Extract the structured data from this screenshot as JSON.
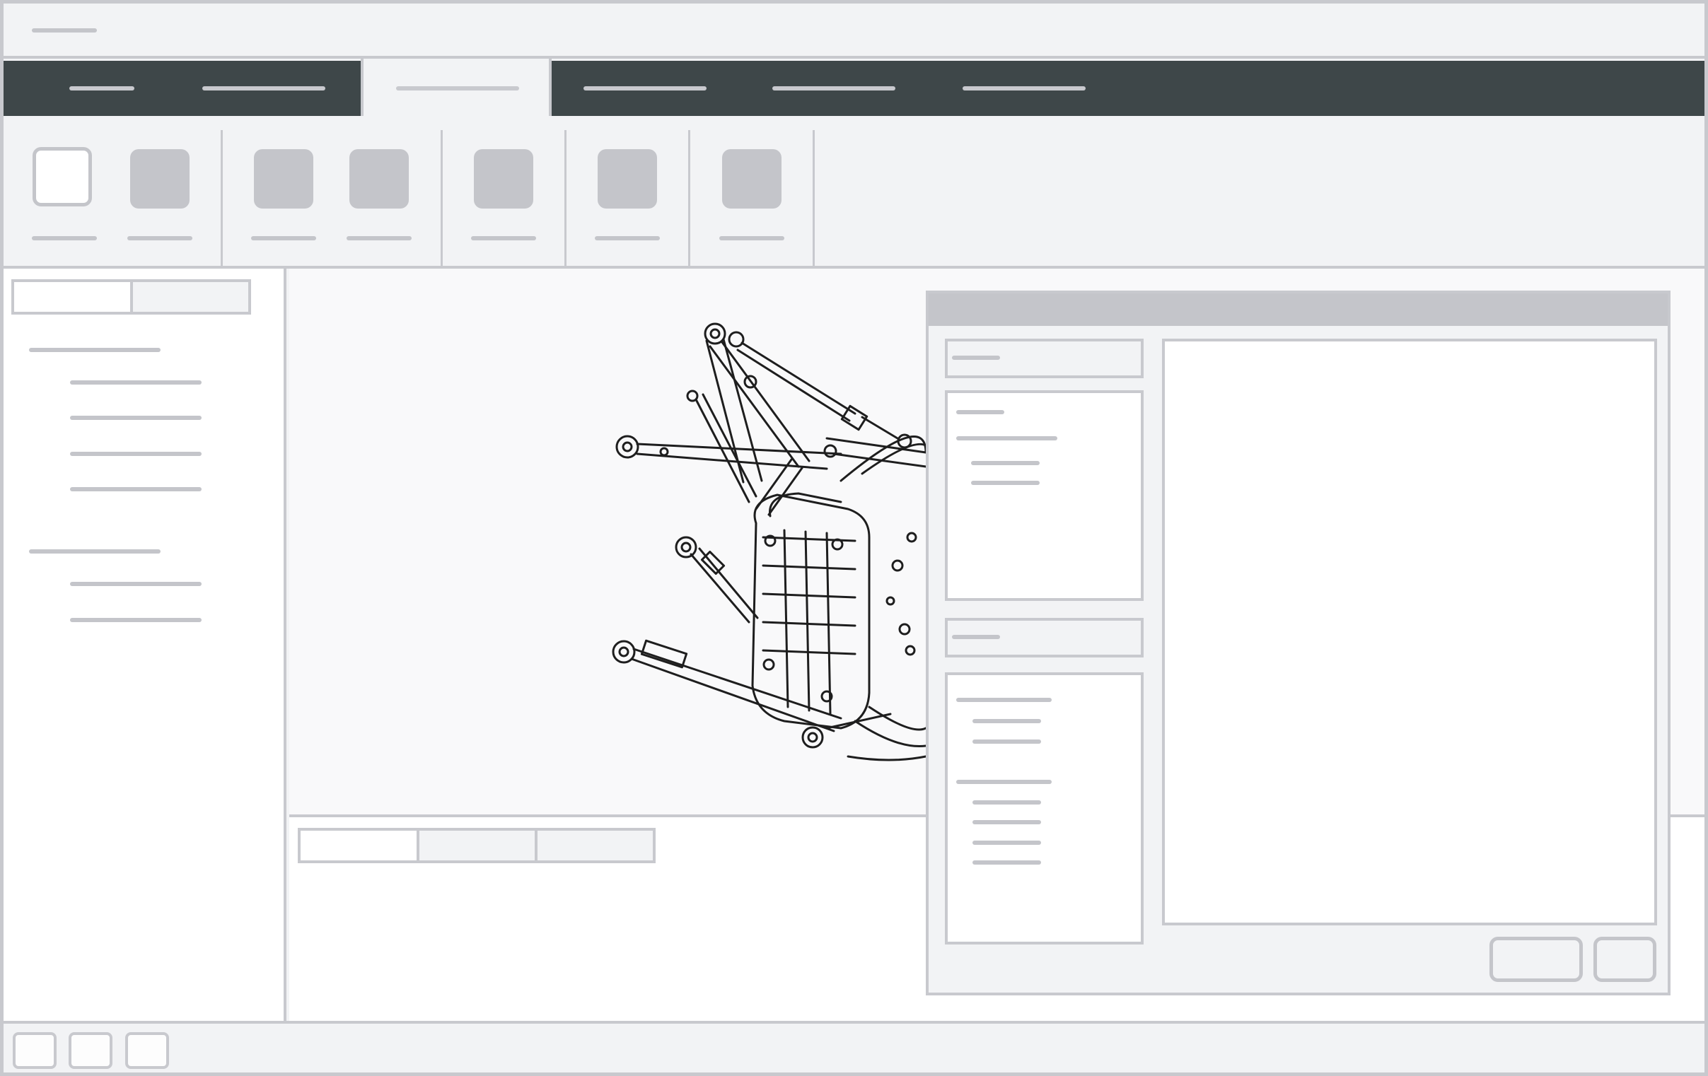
{
  "window": {
    "title": ""
  },
  "ribbon_tabs": [
    {
      "label": "",
      "active": false
    },
    {
      "label": "",
      "active": false
    },
    {
      "label": "",
      "active": true
    },
    {
      "label": "",
      "active": false
    },
    {
      "label": "",
      "active": false
    },
    {
      "label": "",
      "active": false
    }
  ],
  "toolbar_buttons": [
    {
      "label": "",
      "selected": true
    },
    {
      "label": "",
      "selected": false
    },
    {
      "label": "",
      "selected": false
    },
    {
      "label": "",
      "selected": false
    },
    {
      "label": "",
      "selected": false
    },
    {
      "label": "",
      "selected": false
    },
    {
      "label": "",
      "selected": false
    }
  ],
  "left_panel": {
    "tabs": [
      {
        "label": "",
        "active": true
      },
      {
        "label": "",
        "active": false
      }
    ],
    "groups": [
      {
        "title": "",
        "items": [
          "",
          "",
          "",
          ""
        ]
      },
      {
        "title": "",
        "items": [
          "",
          ""
        ]
      }
    ]
  },
  "viewport": {
    "model": "brake-caliper-suspension-assembly"
  },
  "bottom_panel": {
    "tabs": [
      {
        "label": "",
        "active": true
      },
      {
        "label": "",
        "active": false
      },
      {
        "label": "",
        "active": false
      }
    ]
  },
  "dialog": {
    "title": "",
    "field_1": "",
    "list_1": {
      "title": "",
      "items": [
        "",
        "",
        ""
      ]
    },
    "field_2": "",
    "list_2": [
      {
        "title": "",
        "items": [
          "",
          ""
        ]
      },
      {
        "title": "",
        "items": [
          "",
          "",
          "",
          ""
        ]
      }
    ],
    "primary_button": "",
    "secondary_button": ""
  },
  "status_bar": {
    "buttons": [
      "",
      "",
      ""
    ]
  },
  "colors": {
    "tab_bar": "#3e4749",
    "border": "#c8c9ce",
    "panel": "#f2f3f5",
    "placeholder": "#c4c5ca"
  }
}
